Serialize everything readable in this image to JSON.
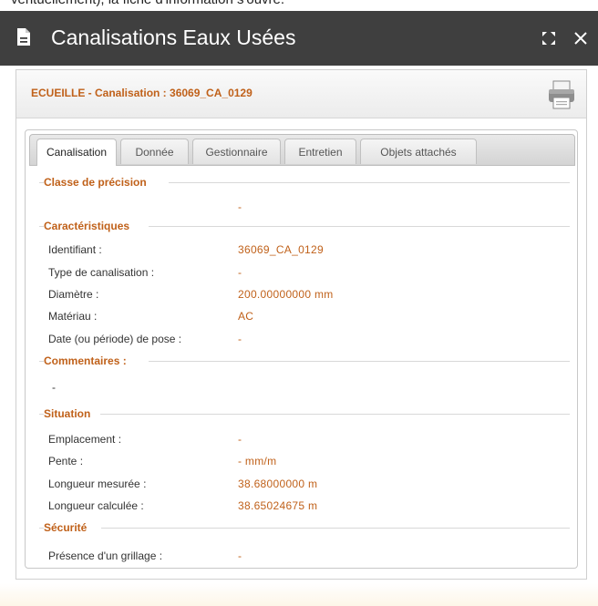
{
  "top_strip_text": "ventuellement), la fiche d'information s'ouvre.",
  "window": {
    "title": "Canalisations Eaux Usées"
  },
  "panel": {
    "title": "ECUEILLE - Canalisation : 36069_CA_0129"
  },
  "tabs": [
    {
      "label": "Canalisation",
      "active": true
    },
    {
      "label": "Donnée",
      "active": false
    },
    {
      "label": "Gestionnaire",
      "active": false
    },
    {
      "label": "Entretien",
      "active": false
    },
    {
      "label": "Objets attachés",
      "active": false
    }
  ],
  "sections": {
    "classe": {
      "title": "Classe de précision",
      "value": "-"
    },
    "caracteristiques": {
      "title": "Caractéristiques",
      "rows": [
        {
          "label": "Identifiant :",
          "value": "36069_CA_0129"
        },
        {
          "label": "Type de canalisation :",
          "value": "-"
        },
        {
          "label": "Diamètre :",
          "value": "200.00000000 mm"
        },
        {
          "label": "Matériau :",
          "value": "AC"
        },
        {
          "label": "Date (ou période) de pose :",
          "value": "-"
        }
      ]
    },
    "commentaires": {
      "title": "Commentaires :",
      "value": "-"
    },
    "situation": {
      "title": "Situation",
      "rows": [
        {
          "label": "Emplacement :",
          "value": "-"
        },
        {
          "label": "Pente :",
          "value": "- mm/m"
        },
        {
          "label": "Longueur mesurée :",
          "value": "38.68000000 m"
        },
        {
          "label": "Longueur calculée :",
          "value": "38.65024675 m"
        }
      ]
    },
    "securite": {
      "title": "Sécurité",
      "rows": [
        {
          "label": "Présence d'un grillage :",
          "value": "-"
        }
      ]
    }
  },
  "colors": {
    "accent": "#c0611a",
    "titlebar": "#3f3f3f"
  }
}
